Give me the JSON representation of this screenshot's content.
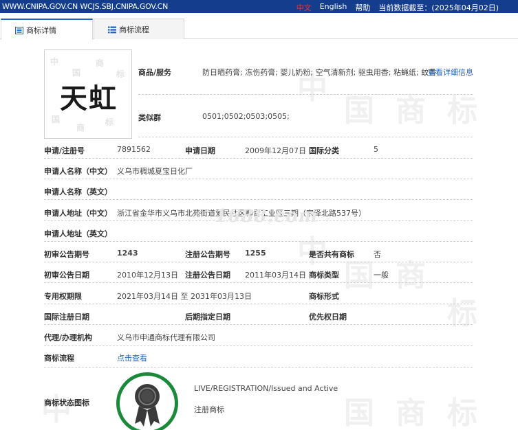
{
  "topbar": {
    "site": "WWW.CNIPA.GOV.CN WCJS.SBJ.CNIPA.GOV.CN",
    "lang_zh": "中文",
    "lang_en": "English",
    "help": "帮助",
    "data_as_of": "当前数据截至：(2025年04月02日)"
  },
  "tabs": {
    "detail": "商标详情",
    "process": "商标流程"
  },
  "logo": {
    "text": "天虹"
  },
  "goods": {
    "label": "商品/服务",
    "value": "防日晒药膏; 冻伤药膏; 婴儿奶粉; 空气清新剂; 驱虫用香; 粘蝇纸; 蚊香",
    "link": "查看详细信息"
  },
  "similar": {
    "label": "类似群",
    "value": "0501;0502;0503;0505;"
  },
  "rows": {
    "reg_no_label": "申请/注册号",
    "reg_no": "7891562",
    "app_date_label": "申请日期",
    "app_date": "2009年12月07日",
    "intl_class_label": "国际分类",
    "intl_class": "5",
    "applicant_cn_label": "申请人名称（中文）",
    "applicant_cn": "义乌市稠城夏宝日化厂",
    "applicant_en_label": "申请人名称（英文）",
    "address_cn_label": "申请人地址（中文）",
    "address_cn": "浙江省金华市义乌市北苑街道爱民社区柳青工业区三期（宗泽北路537号）",
    "address_en_label": "申请人地址（英文）",
    "prelim_no_label": "初审公告期号",
    "prelim_no": "1243",
    "reg_pub_no_label": "注册公告期号",
    "reg_pub_no": "1255",
    "shared_label": "是否共有商标",
    "shared": "否",
    "prelim_date_label": "初审公告日期",
    "prelim_date": "2010年12月13日",
    "reg_pub_date_label": "注册公告日期",
    "reg_pub_date": "2011年03月14日",
    "mark_type_label": "商标类型",
    "mark_type": "一般",
    "term_label": "专用权期限",
    "term": "2021年03月14日 至 2031年03月13日",
    "mark_form_label": "商标形式",
    "intl_reg_date_label": "国际注册日期",
    "later_date_label": "后期指定日期",
    "priority_date_label": "优先权日期",
    "agent_label": "代理/办理机构",
    "agent": "义乌市申通商标代理有限公司",
    "process_label": "商标流程",
    "process_link": "点击查看",
    "status_icon_label": "商标状态图标",
    "status_en": "LIVE/REGISTRATION/Issued and Active",
    "status_cn": "注册商标"
  },
  "watermark": {
    "site": "1688.com",
    "ch1": "中",
    "ch2": "国",
    "ch3": "商",
    "ch4": "标"
  },
  "colors": {
    "topbar": "#143d8e",
    "link": "#1f63c0",
    "badge_ring": "#1a8a3a",
    "zh_active": "#e23b2e"
  }
}
